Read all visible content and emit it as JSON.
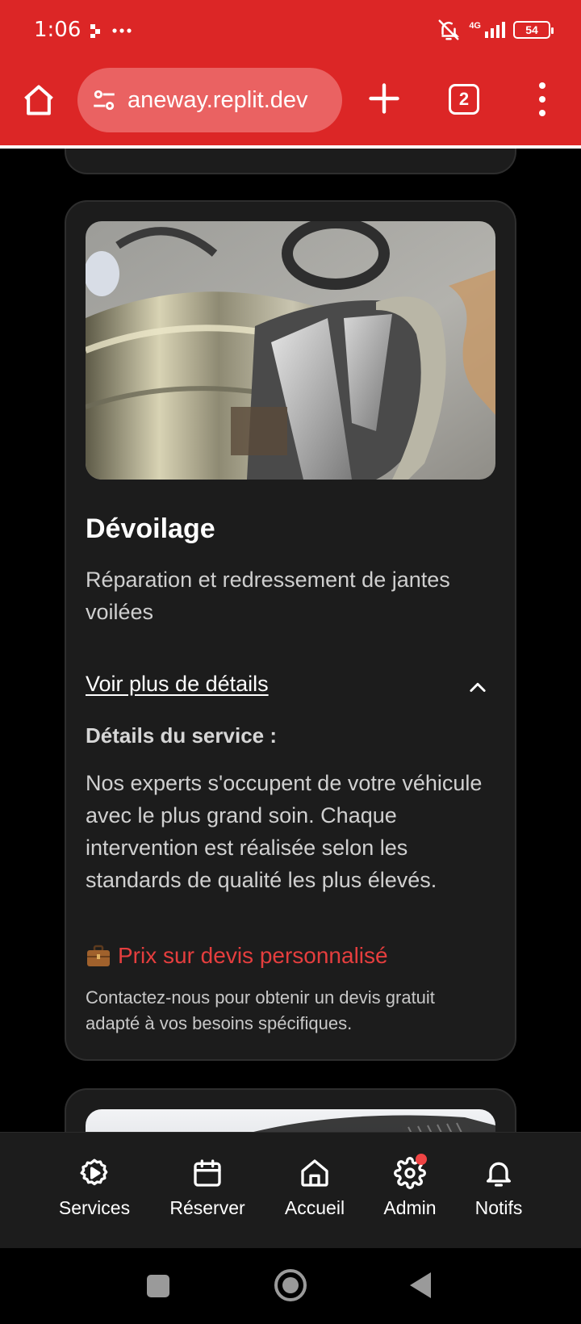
{
  "status_bar": {
    "time": "1:06",
    "network": "4G",
    "battery": "54"
  },
  "browser": {
    "url": "aneway.replit.dev",
    "tab_count": "2"
  },
  "service_card": {
    "title": "Dévoilage",
    "description": "Réparation et redressement de jantes voilées",
    "details_link": "Voir plus de détails",
    "details_heading": "Détails du service :",
    "details_body": "Nos experts s'occupent de votre véhicule avec le plus grand soin. Chaque intervention est réalisée selon les standards de qualité les plus élevés.",
    "price": "Prix sur devis personnalisé",
    "contact": "Contactez-nous pour obtenir un devis gratuit adapté à vos besoins spécifiques.",
    "price_icon": "briefcase-icon"
  },
  "bottom_nav": {
    "items": [
      {
        "label": "Services",
        "icon": "settings-play-icon"
      },
      {
        "label": "Réserver",
        "icon": "calendar-icon"
      },
      {
        "label": "Accueil",
        "icon": "home-icon"
      },
      {
        "label": "Admin",
        "icon": "gear-icon"
      },
      {
        "label": "Notifs",
        "icon": "bell-icon"
      }
    ]
  },
  "colors": {
    "accent": "#dc2626",
    "card_bg": "#1c1c1c",
    "price": "#e53e3e"
  }
}
